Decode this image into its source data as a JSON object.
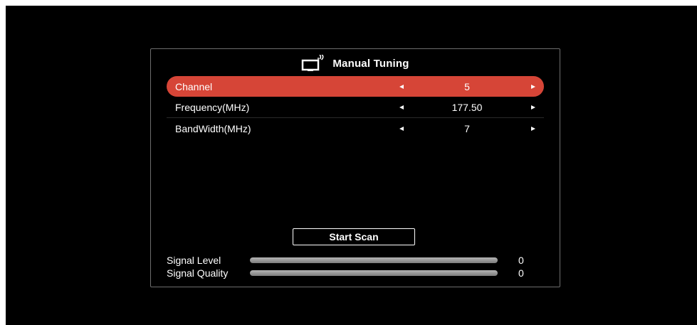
{
  "window": {
    "title": "Manual Tuning",
    "title_icon": "tv-antenna-icon"
  },
  "settings": [
    {
      "label": "Channel",
      "value": "5",
      "selected": true
    },
    {
      "label": "Frequency(MHz)",
      "value": "177.50",
      "selected": false
    },
    {
      "label": "BandWidth(MHz)",
      "value": "7",
      "selected": false
    }
  ],
  "scan_button": {
    "label": "Start Scan"
  },
  "signal": {
    "level": {
      "label": "Signal Level",
      "value": "0",
      "fraction": 0
    },
    "quality": {
      "label": "Signal Quality",
      "value": "0",
      "fraction": 0
    }
  },
  "colors": {
    "selection": "#d64537",
    "background": "#000000",
    "text": "#ffffff",
    "bar_track": "#9a9a9a"
  }
}
